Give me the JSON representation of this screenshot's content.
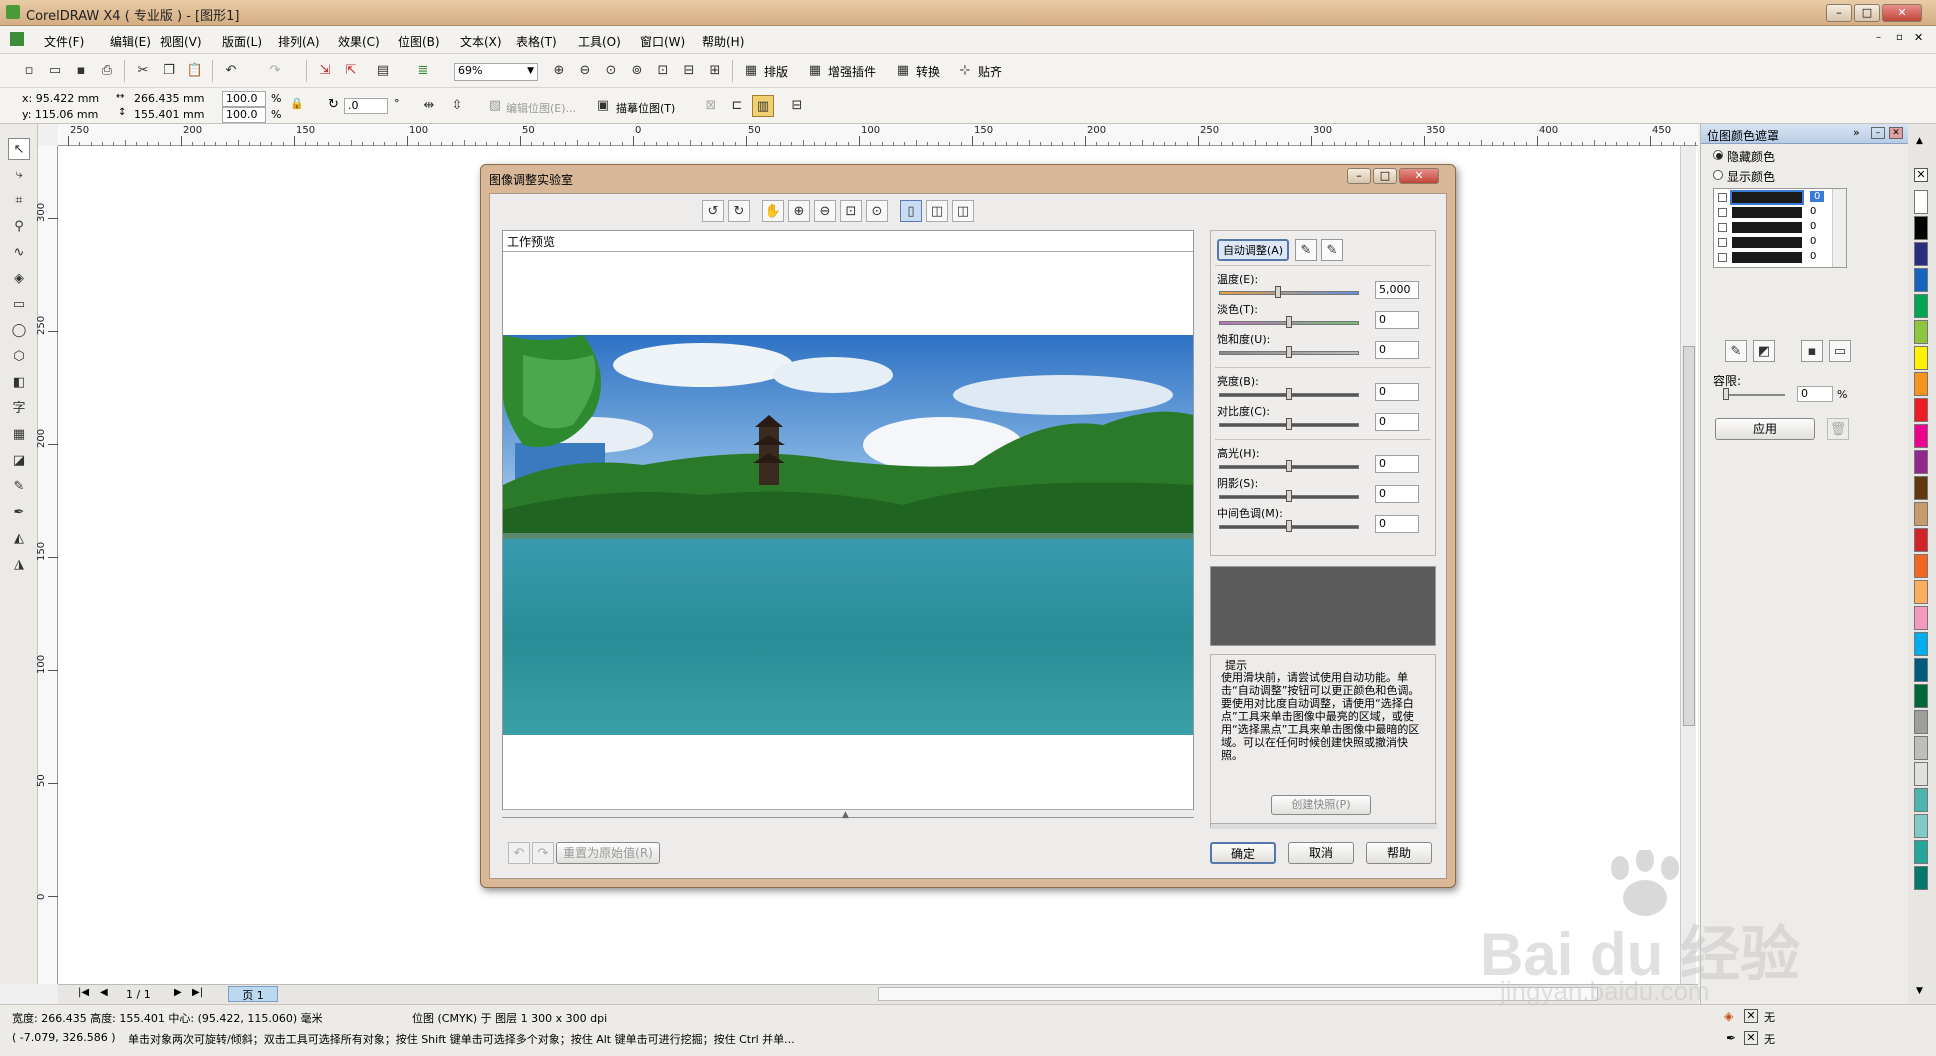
{
  "app": {
    "title": "CorelDRAW X4 ( 专业版 ) - [图形1]",
    "menus": [
      "文件(F)",
      "编辑(E)",
      "视图(V)",
      "版面(L)",
      "排列(A)",
      "效果(C)",
      "位图(B)",
      "文本(X)",
      "表格(T)",
      "工具(O)",
      "窗口(W)",
      "帮助(H)"
    ]
  },
  "toolbar": {
    "zoom": "69%",
    "actions": [
      "排版",
      "增强插件",
      "转换",
      "贴齐"
    ]
  },
  "property_bar": {
    "x": "x: 95.422 mm",
    "y": "y: 115.06 mm",
    "width": "266.435 mm",
    "height": "155.401 mm",
    "scale_x": "100.0",
    "scale_y": "100.0",
    "pct": "%",
    "angle": ".0",
    "deg": "°",
    "edit_bitmap": "编辑位图(E)...",
    "trace_bitmap": "描摹位图(T)"
  },
  "ruler": {
    "h_ticks": [
      "250",
      "200",
      "150",
      "100",
      "50",
      "0",
      "50",
      "100",
      "150",
      "200",
      "250",
      "300",
      "350",
      "400",
      "450"
    ],
    "v_ticks": [
      "300",
      "250",
      "200",
      "150",
      "100",
      "50",
      "0"
    ]
  },
  "dialog": {
    "title": "图像调整实验室",
    "preview_label": "工作预览",
    "auto_adjust": "自动调整(A)",
    "sliders": [
      {
        "label": "温度(E):",
        "value": "5,000",
        "pos": 0.42,
        "track": "temp"
      },
      {
        "label": "淡色(T):",
        "value": "0",
        "pos": 0.5,
        "track": "tint"
      },
      {
        "label": "饱和度(U):",
        "value": "0",
        "pos": 0.5,
        "track": "gray"
      },
      {
        "label": "亮度(B):",
        "value": "0",
        "pos": 0.5,
        "track": "dark"
      },
      {
        "label": "对比度(C):",
        "value": "0",
        "pos": 0.5,
        "track": "dark"
      },
      {
        "label": "高光(H):",
        "value": "0",
        "pos": 0.5,
        "track": "dark"
      },
      {
        "label": "阴影(S):",
        "value": "0",
        "pos": 0.5,
        "track": "dark"
      },
      {
        "label": "中间色调(M):",
        "value": "0",
        "pos": 0.5,
        "track": "dark"
      }
    ],
    "hint_title": "提示",
    "hint_text": "使用滑块前，请尝试使用自动功能。单击“自动调整”按钮可以更正颜色和色调。要使用对比度自动调整，请使用“选择白点”工具来单击图像中最亮的区域，或使用“选择黑点”工具来单击图像中最暗的区域。可以在任何时候创建快照或撤消快照。",
    "snapshot": "创建快照(P)",
    "reset": "重置为原始值(R)",
    "ok": "确定",
    "cancel": "取消",
    "help": "帮助"
  },
  "docker": {
    "title": "位图颜色遮罩",
    "hide_color": "隐藏颜色",
    "show_color": "显示颜色",
    "rows": [
      "0",
      "0",
      "0",
      "0",
      "0"
    ],
    "tolerance_label": "容限:",
    "tolerance_value": "0",
    "pct": "%",
    "apply": "应用"
  },
  "pagebar": {
    "page_count": "1 / 1",
    "page_tab": "页 1"
  },
  "status": {
    "size": "宽度: 266.435 高度: 155.401 中心: (95.422, 115.060) 毫米",
    "object": "位图 (CMYK) 于 图层 1 300 x 300 dpi",
    "coords": "( -7.079, 326.586 )",
    "hint": "单击对象两次可旋转/倾斜；双击工具可选择所有对象；按住 Shift 键单击可选择多个对象；按住 Alt 键单击可进行挖掘；按住 Ctrl 并单...",
    "fill": "无",
    "outline": "无"
  },
  "watermark": {
    "text": "Bai du 经验",
    "url": "jingyan.baidu.com"
  },
  "palette_colors": [
    "#ffffff",
    "#000000",
    "#2b2e7e",
    "#1565c0",
    "#00a651",
    "#8dc63f",
    "#fff200",
    "#f7941d",
    "#ed1c24",
    "#ec008c",
    "#92278f",
    "#603913",
    "#c69c6d",
    "#d2232a",
    "#f26522",
    "#fbaf5d",
    "#f49ac1",
    "#00aeef",
    "#005b7f",
    "#006837",
    "#9e9e9e",
    "#bdbdbd",
    "#e0e0e0",
    "#4db6ac",
    "#80cbc4",
    "#26a69a",
    "#00796b"
  ]
}
